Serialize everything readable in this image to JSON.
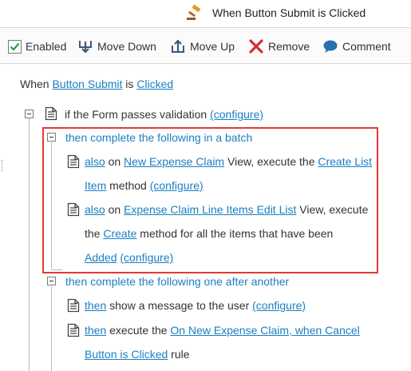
{
  "title": {
    "icon": "gavel-icon",
    "text": "When Button Submit is Clicked"
  },
  "toolbar": {
    "enabled_label": "Enabled",
    "enabled_checked": true,
    "move_down_label": "Move Down",
    "move_up_label": "Move Up",
    "remove_label": "Remove",
    "comment_label": "Comment"
  },
  "rule": {
    "when": "When",
    "control": "Button Submit",
    "is": "is",
    "event": "Clicked"
  },
  "condition": {
    "text": "if the Form passes validation",
    "configure": "(configure)"
  },
  "batch": {
    "header": "then complete the following in a batch",
    "action1": {
      "also": "also",
      "on": "on",
      "view": "New Expense Claim",
      "mid": "View, execute the",
      "method_a": "Create List",
      "method_b": "Item",
      "method_word": "method",
      "configure": "(configure)"
    },
    "action2": {
      "also": "also",
      "on": "on",
      "view": "Expense Claim Line Items Edit List",
      "mid": "View, execute",
      "the": "the",
      "method": "Create",
      "rest": "method for all the items that have been",
      "added": "Added",
      "configure": "(configure)"
    }
  },
  "sequence": {
    "header": "then complete the following one after another",
    "action1": {
      "then": "then",
      "text": "show a message to the user",
      "configure": "(configure)"
    },
    "action2": {
      "then": "then",
      "text": "execute the",
      "rule_a": "On New Expense Claim, when Cancel",
      "rule_b": "Button is Clicked",
      "rule_word": "rule"
    }
  },
  "colors": {
    "link": "#1a7fc1",
    "highlight": "#e53935",
    "check": "#2e9a3c",
    "remove": "#d32f2f",
    "comment": "#2a6fb0"
  }
}
